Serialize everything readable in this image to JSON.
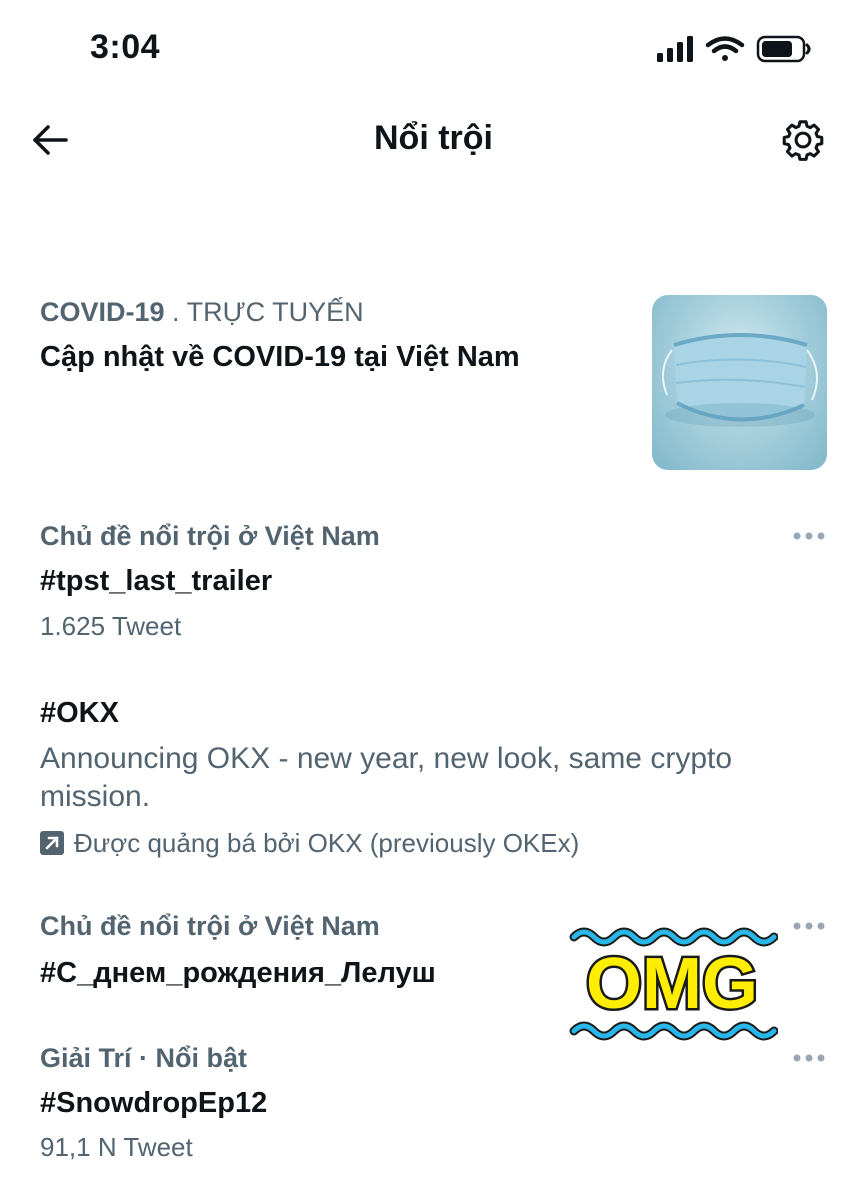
{
  "status_bar": {
    "time": "3:04"
  },
  "header": {
    "title": "Nổi trội"
  },
  "covid": {
    "category": "COVID-19",
    "separator": " . ",
    "live": "TRỰC TUYẾN",
    "title": "Cập nhật về COVID-19 tại Việt Nam"
  },
  "trends": [
    {
      "context": "Chủ đề nổi trội ở Việt Nam",
      "name": "#tpst_last_trailer",
      "count": "1.625 Tweet"
    },
    {
      "context": "Chủ đề nổi trội ở Việt Nam",
      "name": "#С_днем_рождения_Лелуш"
    },
    {
      "context": "Giải Trí · Nổi bật",
      "name": "#SnowdropEp12",
      "count": "91,1 N Tweet"
    }
  ],
  "promoted": {
    "name": "#OKX",
    "description": "Announcing OKX - new year, new look, same crypto mission.",
    "promoted_by": "Được quảng bá bởi OKX (previously OKEx)"
  },
  "sticker": {
    "text": "OMG"
  },
  "icons": {
    "back": "arrow-left-icon",
    "settings": "gear-icon",
    "more": "more-horizontal-icon",
    "promoted": "promoted-arrow-icon",
    "signal": "cellular-signal-icon",
    "wifi": "wifi-icon",
    "battery": "battery-icon"
  },
  "colors": {
    "text": "#0f1419",
    "secondary": "#536471",
    "sticker_fill": "#ffee00",
    "sticker_wave": "#29b6e8"
  }
}
